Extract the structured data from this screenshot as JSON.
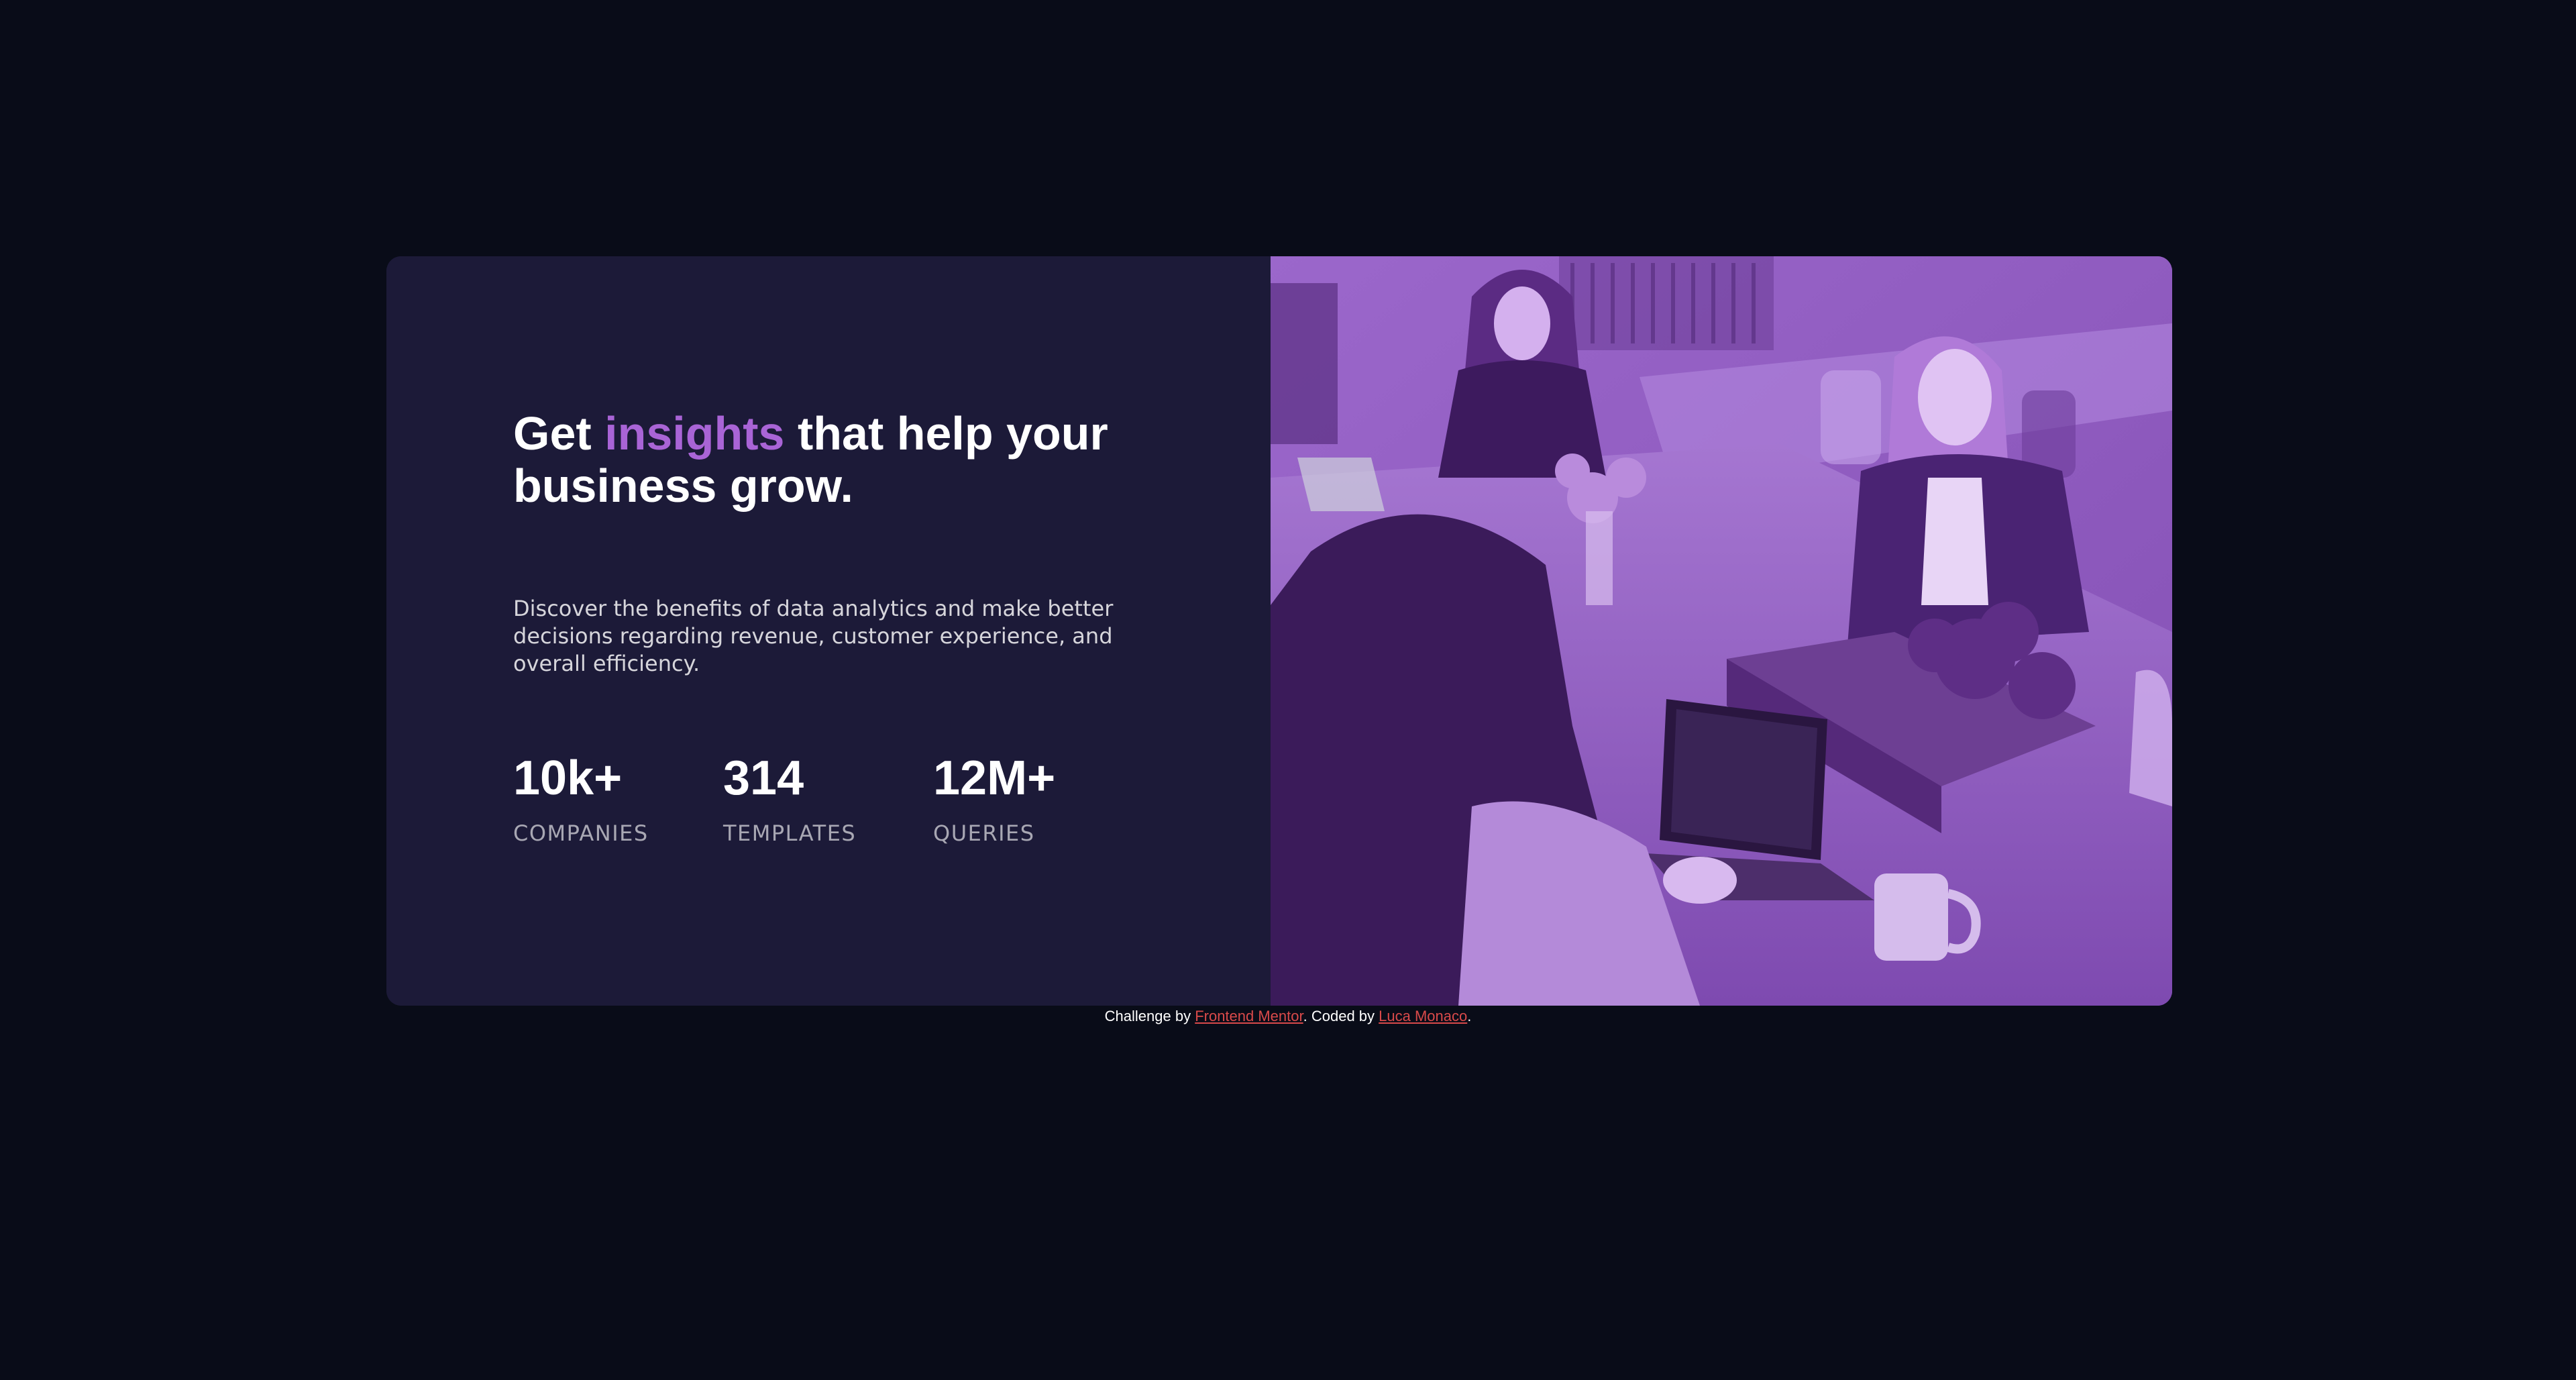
{
  "hero": {
    "headline_start": "Get ",
    "headline_accent": "insights",
    "headline_end": " that help your business grow.",
    "description": "Discover the benefits of data analytics and make better decisions regarding revenue, customer experience, and overall efficiency."
  },
  "stats": [
    {
      "value": "10k+",
      "label": "COMPANIES"
    },
    {
      "value": "314",
      "label": "TEMPLATES"
    },
    {
      "value": "12M+",
      "label": "QUERIES"
    }
  ],
  "footer": {
    "prefix": "Challenge by ",
    "link1": "Frontend Mentor",
    "middle": ". Coded by ",
    "link2": "Luca Monaco",
    "suffix": "."
  },
  "colors": {
    "page_background": "#090c18",
    "card_background": "#1c1a38",
    "accent": "#a964d6",
    "image_tint": "#9661c5",
    "link": "#d94a4a"
  }
}
